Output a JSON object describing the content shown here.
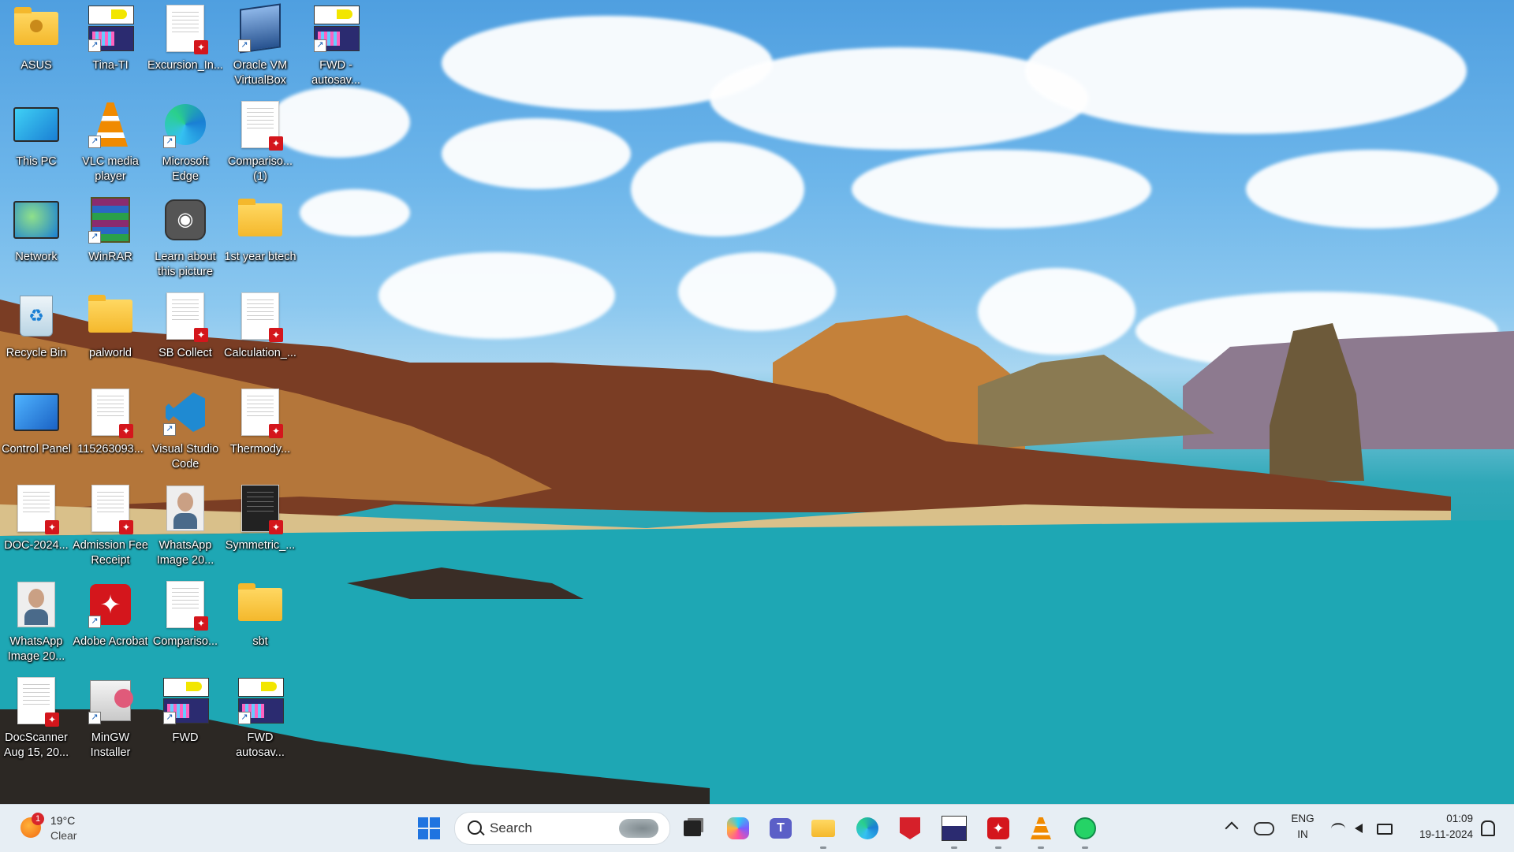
{
  "desktop_icons": [
    {
      "label": "ASUS",
      "kind": "user-folder"
    },
    {
      "label": "Tina-TI",
      "kind": "fwd-app"
    },
    {
      "label": "Excursion_In...",
      "kind": "pdf"
    },
    {
      "label": "Oracle VM VirtualBox",
      "kind": "virtualbox"
    },
    {
      "label": "FWD - autosav...",
      "kind": "fwd-app"
    },
    {
      "label": "This PC",
      "kind": "monitor"
    },
    {
      "label": "VLC media player",
      "kind": "vlc"
    },
    {
      "label": "Microsoft Edge",
      "kind": "edge"
    },
    {
      "label": "Compariso... (1)",
      "kind": "pdf"
    },
    {
      "label": "Network",
      "kind": "network"
    },
    {
      "label": "WinRAR",
      "kind": "winrar"
    },
    {
      "label": "Learn about this picture",
      "kind": "learn"
    },
    {
      "label": "1st year btech",
      "kind": "folder"
    },
    {
      "label": "Recycle Bin",
      "kind": "recycle"
    },
    {
      "label": "palworld",
      "kind": "folder"
    },
    {
      "label": "SB Collect",
      "kind": "pdf"
    },
    {
      "label": "Calculation_...",
      "kind": "pdf"
    },
    {
      "label": "Control Panel",
      "kind": "control-panel"
    },
    {
      "label": "115263093...",
      "kind": "pdf"
    },
    {
      "label": "Visual Studio Code",
      "kind": "vscode"
    },
    {
      "label": "Thermody...",
      "kind": "pdf"
    },
    {
      "label": "DOC-2024...",
      "kind": "pdf"
    },
    {
      "label": "Admission Fee Receipt",
      "kind": "pdf"
    },
    {
      "label": "WhatsApp Image 20...",
      "kind": "photo"
    },
    {
      "label": "Symmetric_...",
      "kind": "pdf-dark"
    },
    {
      "label": "WhatsApp Image 20...",
      "kind": "photo"
    },
    {
      "label": "Adobe Acrobat",
      "kind": "acrobat"
    },
    {
      "label": "Compariso...",
      "kind": "pdf"
    },
    {
      "label": "sbt",
      "kind": "folder"
    },
    {
      "label": "DocScanner Aug 15, 20...",
      "kind": "pdf"
    },
    {
      "label": "MinGW Installer",
      "kind": "mingw"
    },
    {
      "label": "FWD",
      "kind": "fwd-app"
    },
    {
      "label": "FWD autosav...",
      "kind": "fwd-app"
    }
  ],
  "weather": {
    "badge": "1",
    "temp": "19°C",
    "condition": "Clear"
  },
  "search": {
    "label": "Search"
  },
  "taskbar_apps": [
    "start-icon",
    "task-view-icon",
    "copilot-icon",
    "teams-icon",
    "file-explorer-icon",
    "edge-icon",
    "mcafee-icon",
    "fwd-icon",
    "acrobat-icon",
    "vlc-icon",
    "whatsapp-icon"
  ],
  "tray": {
    "lang_line1": "ENG",
    "lang_line2": "IN",
    "time": "01:09",
    "date": "19-11-2024"
  },
  "colors": {
    "taskbar_bg": "#e7eef4",
    "win_blue": "#1f74e0",
    "acrobat_red": "#d4161c",
    "vlc_orange": "#f08a00"
  }
}
